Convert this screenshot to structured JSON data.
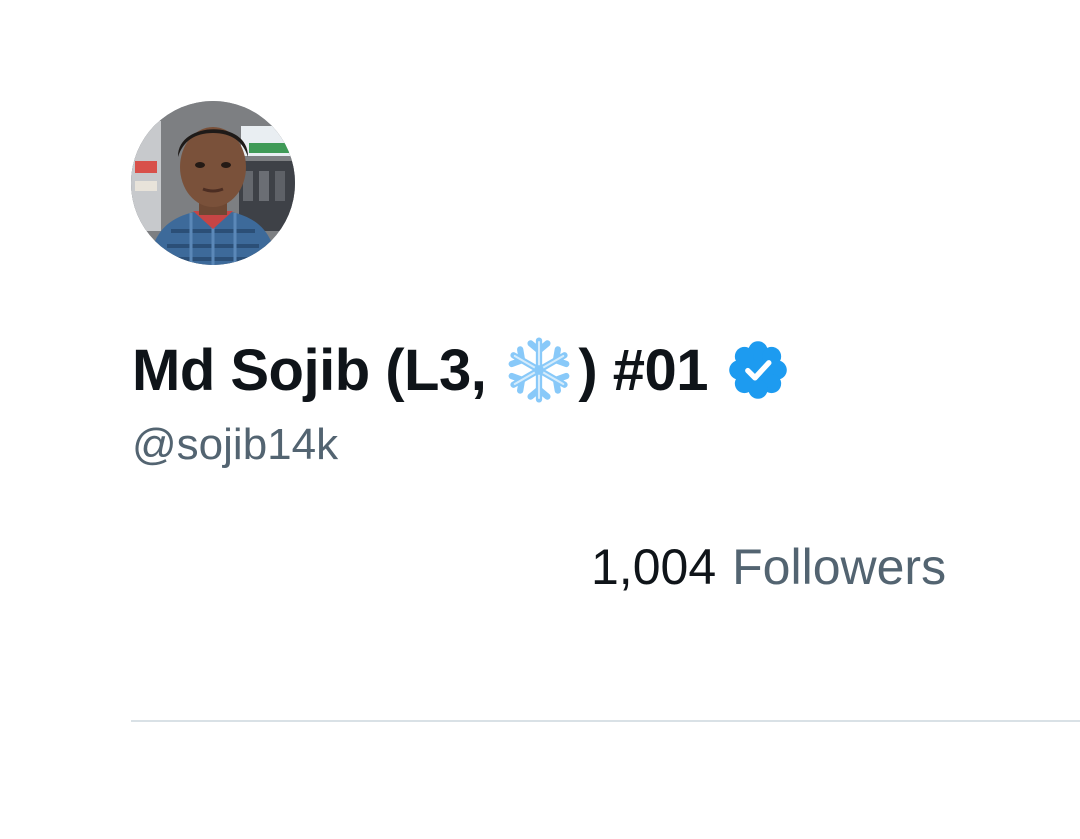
{
  "profile": {
    "name_prefix": "Md Sojib (L3,",
    "name_suffix": ") #01",
    "emoji_icon": "snowflake-icon",
    "badge_icon": "verified-badge-icon",
    "handle": "@sojib14k",
    "followers_count": "1,004",
    "followers_label": "Followers"
  },
  "colors": {
    "text_primary": "#0f1419",
    "text_secondary": "#536471",
    "verified_blue": "#1d9bf0",
    "snowflake_blue": "#88c9f9",
    "divider": "#d9e1e6"
  }
}
